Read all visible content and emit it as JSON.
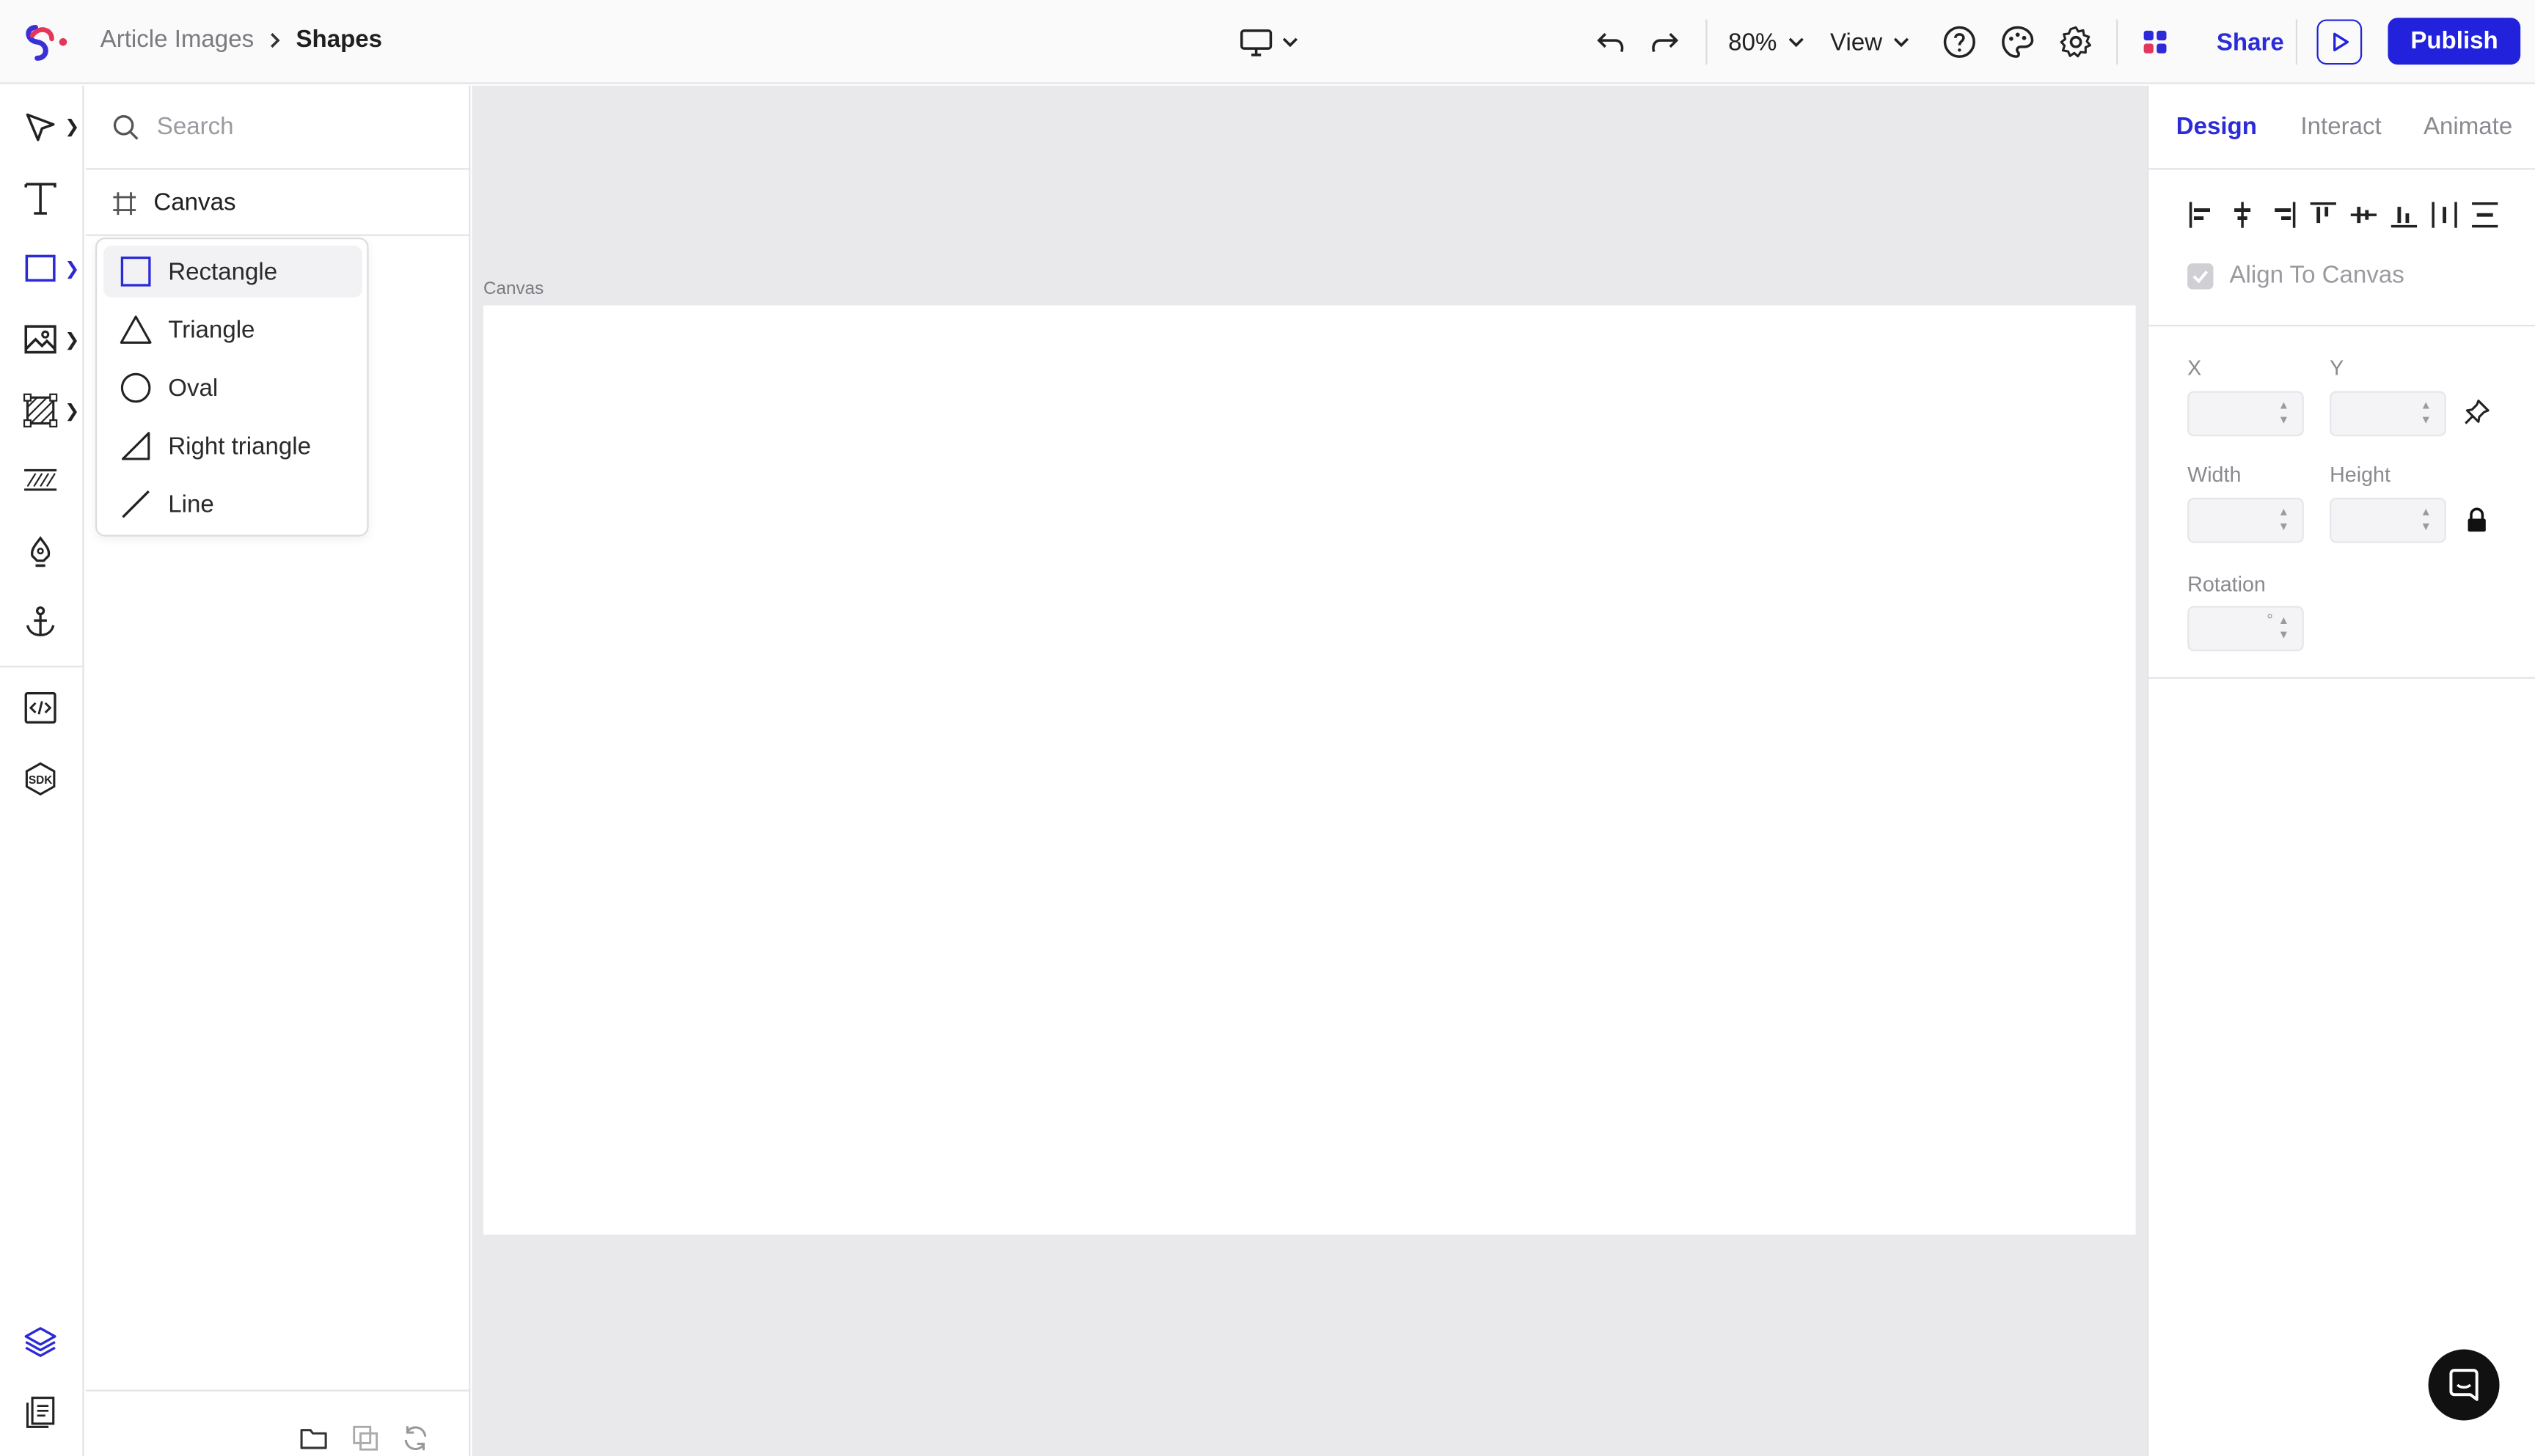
{
  "breadcrumb": {
    "parent": "Article Images",
    "current": "Shapes"
  },
  "toolbar": {
    "zoom": "80%",
    "view_label": "View",
    "share_label": "Share",
    "publish_label": "Publish"
  },
  "layers_panel": {
    "search_placeholder": "Search",
    "layers": [
      {
        "label": "Canvas",
        "icon": "frame-icon"
      }
    ]
  },
  "shapes_menu": {
    "items": [
      {
        "label": "Rectangle",
        "icon": "rectangle-icon",
        "selected": true
      },
      {
        "label": "Triangle",
        "icon": "triangle-icon",
        "selected": false
      },
      {
        "label": "Oval",
        "icon": "oval-icon",
        "selected": false
      },
      {
        "label": "Right triangle",
        "icon": "right-triangle-icon",
        "selected": false
      },
      {
        "label": "Line",
        "icon": "line-icon",
        "selected": false
      }
    ]
  },
  "canvas": {
    "label": "Canvas"
  },
  "right_panel": {
    "tabs": [
      {
        "label": "Design",
        "active": true
      },
      {
        "label": "Interact",
        "active": false
      },
      {
        "label": "Animate",
        "active": false
      }
    ],
    "align_to_canvas_label": "Align To Canvas",
    "align_to_canvas_checked": true,
    "fields": {
      "x": {
        "label": "X",
        "value": ""
      },
      "y": {
        "label": "Y",
        "value": ""
      },
      "width": {
        "label": "Width",
        "value": ""
      },
      "height": {
        "label": "Height",
        "value": ""
      },
      "rotation": {
        "label": "Rotation",
        "value": "",
        "unit": "°"
      }
    }
  },
  "colors": {
    "accent": "#2222dd",
    "workspace_bg": "#e9e9eb"
  }
}
